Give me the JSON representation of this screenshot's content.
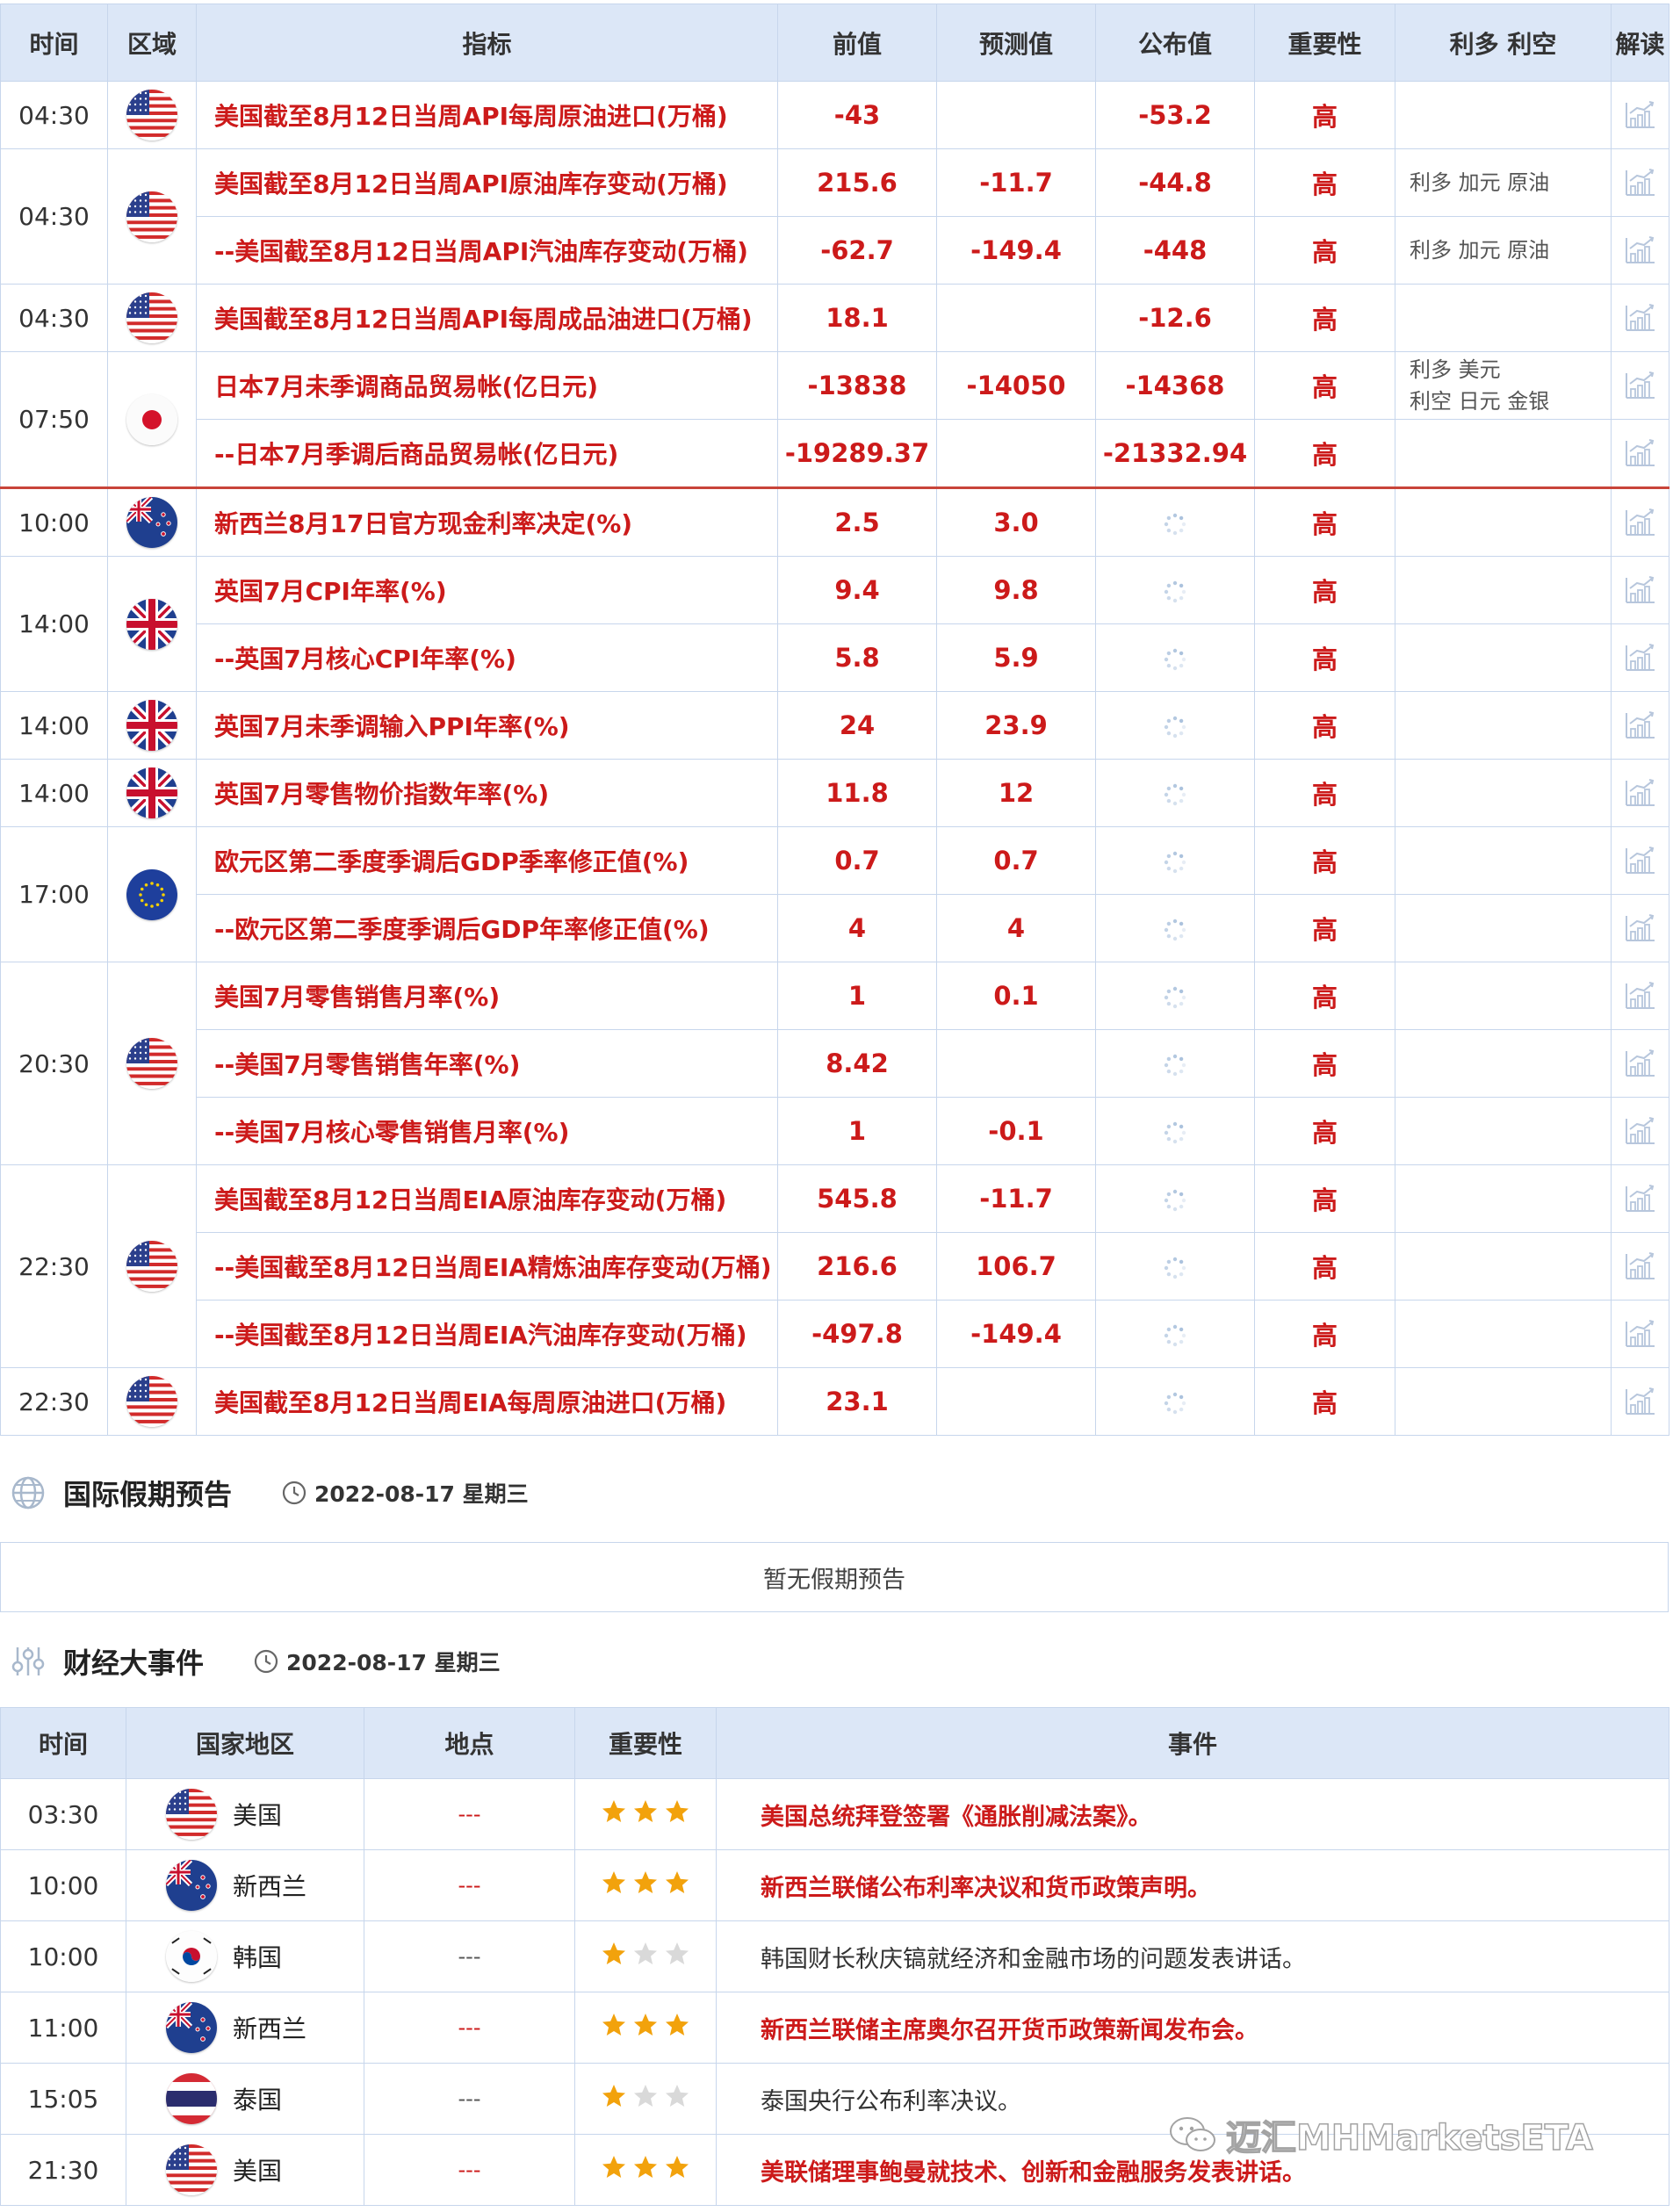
{
  "calendar": {
    "headers": {
      "time": "时间",
      "region": "区域",
      "indicator": "指标",
      "previous": "前值",
      "forecast": "预测值",
      "actual": "公布值",
      "importance": "重要性",
      "effect": "利多 利空",
      "interpret": "解读"
    },
    "groups": [
      {
        "time": "04:30",
        "flag": "us",
        "rows": [
          {
            "indicator": "美国截至8月12日当周API每周原油进口(万桶)",
            "previous": "-43",
            "forecast": "",
            "actual": "-53.2",
            "importance": "高",
            "effect": ""
          }
        ]
      },
      {
        "time": "04:30",
        "flag": "us",
        "rows": [
          {
            "indicator": "美国截至8月12日当周API原油库存变动(万桶)",
            "previous": "215.6",
            "forecast": "-11.7",
            "actual": "-44.8",
            "importance": "高",
            "effect": "利多  加元 原油"
          },
          {
            "indicator": "--美国截至8月12日当周API汽油库存变动(万桶)",
            "previous": "-62.7",
            "forecast": "-149.4",
            "actual": "-448",
            "importance": "高",
            "effect": "利多  加元 原油"
          }
        ]
      },
      {
        "time": "04:30",
        "flag": "us",
        "rows": [
          {
            "indicator": "美国截至8月12日当周API每周成品油进口(万桶)",
            "previous": "18.1",
            "forecast": "",
            "actual": "-12.6",
            "importance": "高",
            "effect": ""
          }
        ]
      },
      {
        "time": "07:50",
        "flag": "jp",
        "rows": [
          {
            "indicator": "日本7月未季调商品贸易帐(亿日元)",
            "previous": "-13838",
            "forecast": "-14050",
            "actual": "-14368",
            "importance": "高",
            "effect": "利多  美元\n利空  日元 金银"
          },
          {
            "indicator": "--日本7月季调后商品贸易帐(亿日元)",
            "previous": "-19289.37",
            "forecast": "",
            "actual": "-21332.94",
            "importance": "高",
            "effect": ""
          }
        ]
      },
      {
        "time": "10:00",
        "flag": "nz",
        "separator": true,
        "rows": [
          {
            "indicator": "新西兰8月17日官方现金利率决定(%)",
            "previous": "2.5",
            "forecast": "3.0",
            "actual": "",
            "importance": "高",
            "effect": ""
          }
        ]
      },
      {
        "time": "14:00",
        "flag": "uk",
        "rows": [
          {
            "indicator": "英国7月CPI年率(%)",
            "previous": "9.4",
            "forecast": "9.8",
            "actual": "",
            "importance": "高",
            "effect": ""
          },
          {
            "indicator": "--英国7月核心CPI年率(%)",
            "previous": "5.8",
            "forecast": "5.9",
            "actual": "",
            "importance": "高",
            "effect": ""
          }
        ]
      },
      {
        "time": "14:00",
        "flag": "uk",
        "rows": [
          {
            "indicator": "英国7月未季调输入PPI年率(%)",
            "previous": "24",
            "forecast": "23.9",
            "actual": "",
            "importance": "高",
            "effect": ""
          }
        ]
      },
      {
        "time": "14:00",
        "flag": "uk",
        "rows": [
          {
            "indicator": "英国7月零售物价指数年率(%)",
            "previous": "11.8",
            "forecast": "12",
            "actual": "",
            "importance": "高",
            "effect": ""
          }
        ]
      },
      {
        "time": "17:00",
        "flag": "eu",
        "rows": [
          {
            "indicator": "欧元区第二季度季调后GDP季率修正值(%)",
            "previous": "0.7",
            "forecast": "0.7",
            "actual": "",
            "importance": "高",
            "effect": ""
          },
          {
            "indicator": "--欧元区第二季度季调后GDP年率修正值(%)",
            "previous": "4",
            "forecast": "4",
            "actual": "",
            "importance": "高",
            "effect": ""
          }
        ]
      },
      {
        "time": "20:30",
        "flag": "us",
        "rows": [
          {
            "indicator": "美国7月零售销售月率(%)",
            "previous": "1",
            "forecast": "0.1",
            "actual": "",
            "importance": "高",
            "effect": ""
          },
          {
            "indicator": "--美国7月零售销售年率(%)",
            "previous": "8.42",
            "forecast": "",
            "actual": "",
            "importance": "高",
            "effect": ""
          },
          {
            "indicator": "--美国7月核心零售销售月率(%)",
            "previous": "1",
            "forecast": "-0.1",
            "actual": "",
            "importance": "高",
            "effect": ""
          }
        ]
      },
      {
        "time": "22:30",
        "flag": "us",
        "rows": [
          {
            "indicator": "美国截至8月12日当周EIA原油库存变动(万桶)",
            "previous": "545.8",
            "forecast": "-11.7",
            "actual": "",
            "importance": "高",
            "effect": ""
          },
          {
            "indicator": "--美国截至8月12日当周EIA精炼油库存变动(万桶)",
            "previous": "216.6",
            "forecast": "106.7",
            "actual": "",
            "importance": "高",
            "effect": ""
          },
          {
            "indicator": "--美国截至8月12日当周EIA汽油库存变动(万桶)",
            "previous": "-497.8",
            "forecast": "-149.4",
            "actual": "",
            "importance": "高",
            "effect": ""
          }
        ]
      },
      {
        "time": "22:30",
        "flag": "us",
        "rows": [
          {
            "indicator": "美国截至8月12日当周EIA每周原油进口(万桶)",
            "previous": "23.1",
            "forecast": "",
            "actual": "",
            "importance": "高",
            "effect": ""
          }
        ]
      }
    ]
  },
  "holiday_section": {
    "title": "国际假期预告",
    "date": "2022-08-17 星期三",
    "empty_text": "暂无假期预告",
    "icon": "globe-icon"
  },
  "events_section": {
    "title": "财经大事件",
    "date": "2022-08-17 星期三",
    "icon": "sliders-icon",
    "headers": {
      "time": "时间",
      "country": "国家地区",
      "place": "地点",
      "importance": "重要性",
      "event": "事件"
    },
    "rows": [
      {
        "time": "03:30",
        "flag": "us",
        "country": "美国",
        "place": "---",
        "stars": 3,
        "event": "美国总统拜登签署《通胀削减法案》。"
      },
      {
        "time": "10:00",
        "flag": "nz",
        "country": "新西兰",
        "place": "---",
        "stars": 3,
        "event": "新西兰联储公布利率决议和货币政策声明。"
      },
      {
        "time": "10:00",
        "flag": "kr",
        "country": "韩国",
        "place": "---",
        "stars": 1,
        "event": "韩国财长秋庆镐就经济和金融市场的问题发表讲话。"
      },
      {
        "time": "11:00",
        "flag": "nz",
        "country": "新西兰",
        "place": "---",
        "stars": 3,
        "event": "新西兰联储主席奥尔召开货币政策新闻发布会。"
      },
      {
        "time": "15:05",
        "flag": "th",
        "country": "泰国",
        "place": "---",
        "stars": 1,
        "event": "泰国央行公布利率决议。"
      },
      {
        "time": "21:30",
        "flag": "us",
        "country": "美国",
        "place": "---",
        "stars": 3,
        "event": "美联储理事鲍曼就技术、创新和金融服务发表讲话。"
      }
    ]
  },
  "watermark": {
    "text": "迈汇MHMarketsETA",
    "icon": "wechat-icon"
  },
  "colors": {
    "accent_red": "#cc1a1a",
    "header_bg": "#dce7f7",
    "border": "#c7d6ec",
    "star_gold": "#f2a20c",
    "star_gray": "#d9d9d9"
  }
}
